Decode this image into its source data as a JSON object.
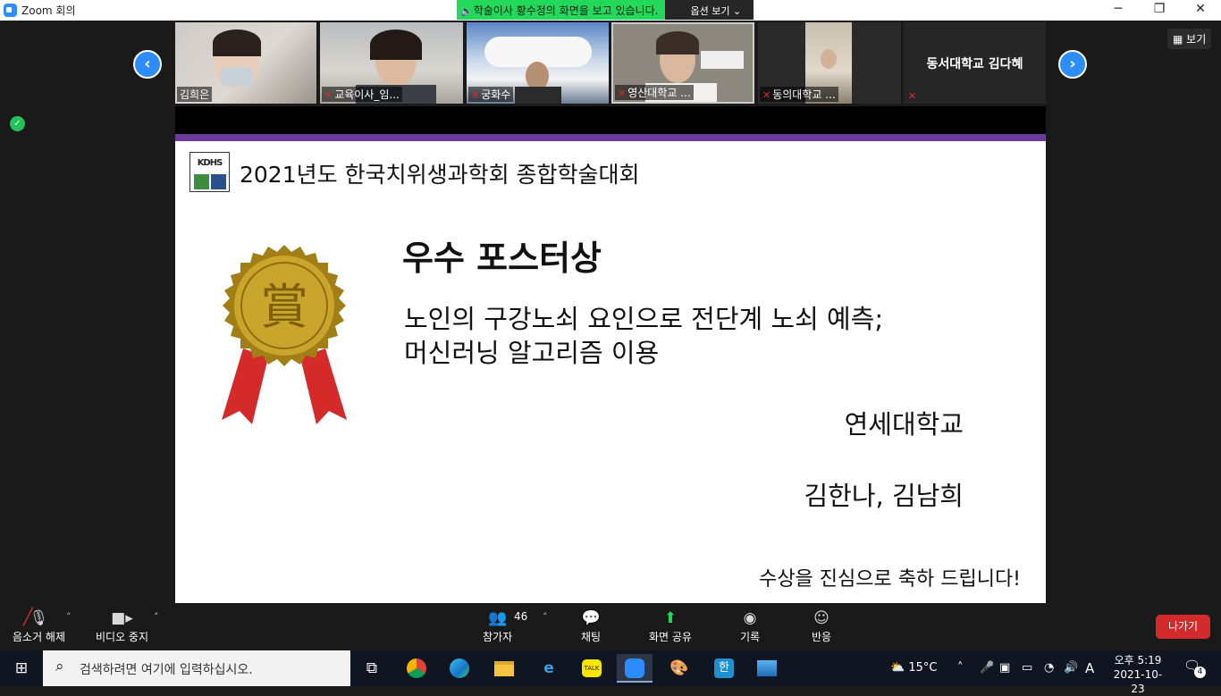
{
  "window": {
    "title": "Zoom 회의"
  },
  "share_banner": {
    "message": "학술이사 황수정의 화면을 보고 있습니다.",
    "options_label": "옵션 보기"
  },
  "view_button": {
    "label": "보기"
  },
  "participants": [
    {
      "name": "김희은",
      "muted": false
    },
    {
      "name": "교육이사_임...",
      "muted": true
    },
    {
      "name": "궁화수",
      "muted": true
    },
    {
      "name": "영산대학교 ...",
      "muted": true
    },
    {
      "name": "동의대학교 ...",
      "muted": true
    },
    {
      "name": "동서대학교 김다혜",
      "muted": true
    }
  ],
  "slide": {
    "logo_text": "KDHS",
    "header": "2021년도 한국치위생과학회 종합학술대회",
    "seal_text": "賞",
    "award_title": "우수 포스터상",
    "paper_title_line1": "노인의 구강노쇠 요인으로 전단계 노쇠 예측;",
    "paper_title_line2": "머신러닝 알고리즘 이용",
    "school": "연세대학교",
    "authors": "김한나, 김남희",
    "congrats": "수상을 진심으로 축하 드립니다!"
  },
  "toolbar": {
    "unmute_label": "음소거 해제",
    "stop_video_label": "비디오 중지",
    "participants_label": "참가자",
    "participants_count": "46",
    "chat_label": "채팅",
    "share_label": "화면 공유",
    "record_label": "기록",
    "reactions_label": "반응",
    "leave_label": "나가기"
  },
  "taskbar": {
    "search_placeholder": "검색하려면 여기에 입력하십시오.",
    "temperature": "15°C",
    "ime": "A",
    "time": "오후 5:19",
    "date": "2021-10-23",
    "notification_count": "4"
  },
  "colors": {
    "zoom_blue": "#2d8cff",
    "share_green": "#23d959",
    "leave_red": "#d32b2b",
    "slide_purple": "#6b3a9c"
  }
}
